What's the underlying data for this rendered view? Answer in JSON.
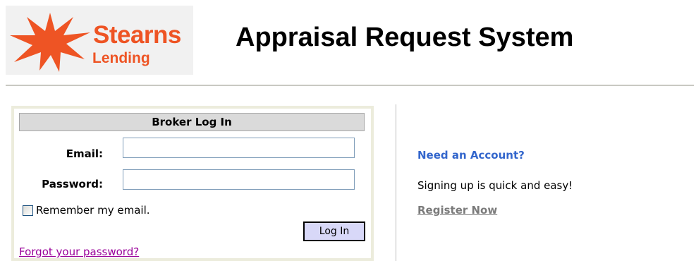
{
  "header": {
    "logo": {
      "name": "Stearns",
      "sub": "Lending",
      "icon": "starburst-logo-icon",
      "color": "#ee5424"
    },
    "title": "Appraisal Request System"
  },
  "login": {
    "panel_title": "Broker Log In",
    "email_label": "Email:",
    "email_value": "",
    "password_label": "Password:",
    "password_value": "",
    "remember_label": "Remember my email.",
    "remember_checked": false,
    "login_button": "Log In",
    "forgot_link": "Forgot your password?"
  },
  "signup": {
    "heading": "Need an Account?",
    "text": "Signing up is quick and easy!",
    "register_link": "Register Now"
  },
  "colors": {
    "brand": "#ee5424",
    "heading_blue": "#3366cc",
    "visited_link": "#990099",
    "button_bg": "#d8d8f8"
  }
}
